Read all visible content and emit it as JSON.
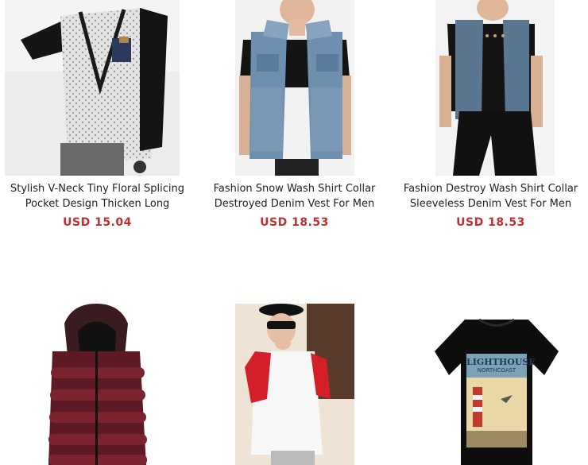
{
  "products": [
    {
      "title_line1": "Stylish V-Neck Tiny Floral Splicing",
      "title_line2": "Pocket Design Thicken Long",
      "price": "USD 15.04",
      "image_alt": "man in floral cardigan"
    },
    {
      "title_line1": "Fashion Snow Wash Shirt Collar",
      "title_line2": "Destroyed Denim Vest For Men",
      "price": "USD 18.53",
      "image_alt": "man in denim vest"
    },
    {
      "title_line1": "Fashion Destroy Wash Shirt Collar",
      "title_line2": "Sleeveless Denim Vest For Men",
      "price": "USD 18.53",
      "image_alt": "man in sleeveless denim vest"
    },
    {
      "title_line1": "",
      "title_line2": "",
      "price": "",
      "image_alt": "red hooded puffer vest"
    },
    {
      "title_line1": "",
      "title_line2": "",
      "price": "",
      "image_alt": "man in raglan tee and cap"
    },
    {
      "title_line1": "",
      "title_line2": "",
      "price": "",
      "image_alt": "black graphic t-shirt",
      "print_line1": "LIGHTHOUSE",
      "print_line2": "NORTHCOAST"
    }
  ]
}
